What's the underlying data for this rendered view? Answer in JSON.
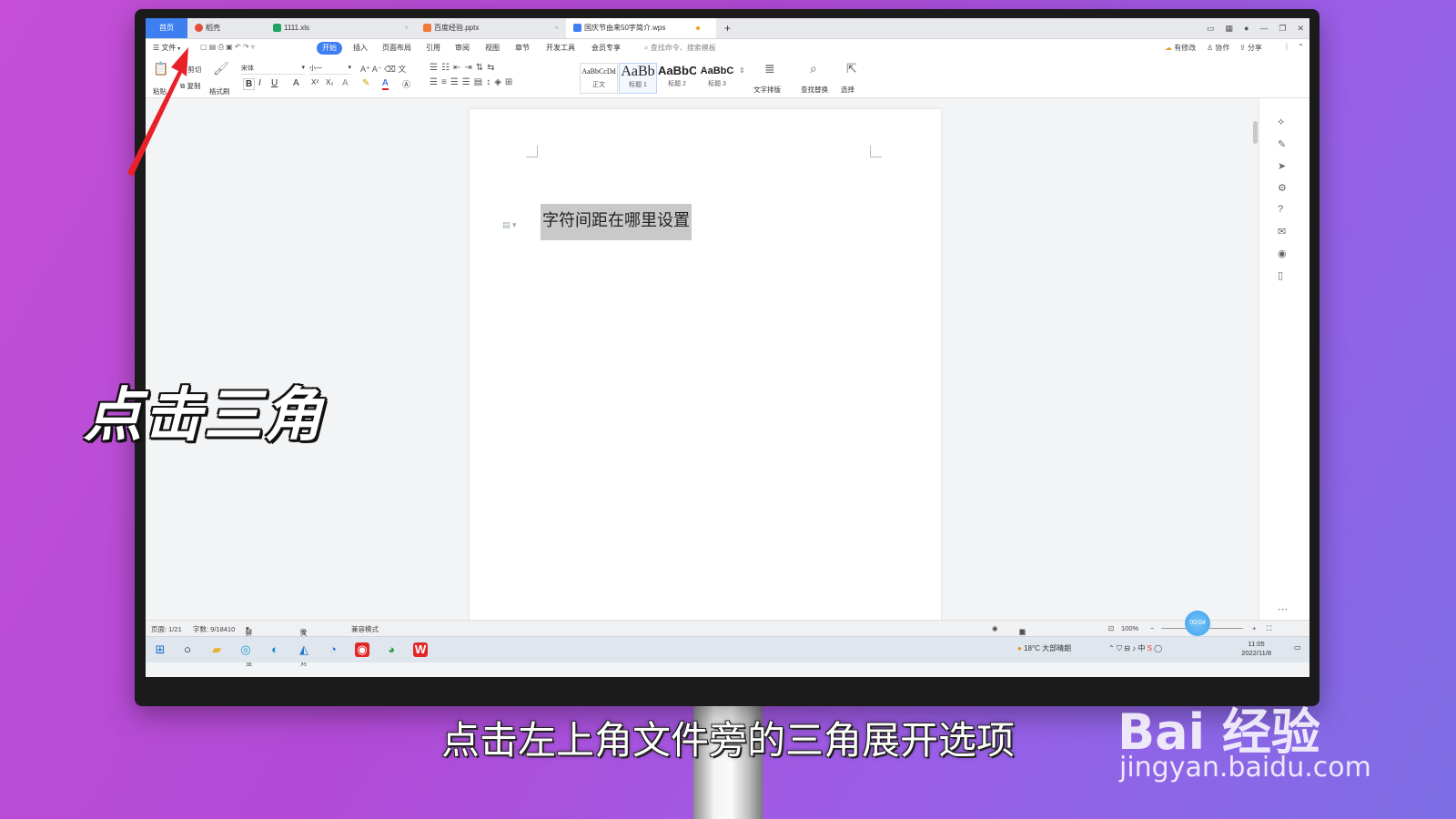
{
  "tabs": [
    {
      "label": "首页"
    },
    {
      "label": "稻壳"
    },
    {
      "label": "1111.xls"
    },
    {
      "label": "百度经验.pptx"
    },
    {
      "label": "国庆节由来50字简介.wps"
    }
  ],
  "new_tab": "+",
  "menu": {
    "file": "文件",
    "items": [
      "开始",
      "插入",
      "页面布局",
      "引用",
      "审阅",
      "视图",
      "章节",
      "开发工具",
      "会员专享"
    ],
    "search_placeholder": "查找命令、搜索模板",
    "right": [
      "有修改",
      "协作",
      "分享"
    ]
  },
  "ribbon": {
    "paste": "粘贴",
    "cut": "剪切",
    "copy": "复制",
    "format_painter": "格式刷",
    "font": "宋体",
    "size": "小一",
    "styles": [
      {
        "preview": "AaBbCcDd",
        "label": "正文"
      },
      {
        "preview": "AaBb",
        "label": "标题 1"
      },
      {
        "preview": "AaBbC",
        "label": "标题 2"
      },
      {
        "preview": "AaBbC",
        "label": "标题 3"
      }
    ],
    "text_layout": "文字排版",
    "find_replace": "查找替换",
    "select": "选择"
  },
  "document": {
    "selected_text": "字符间距在哪里设置"
  },
  "status": {
    "page": "页面: 1/21",
    "words": "字数: 9/18410",
    "spell": "拼写检查",
    "doc_check": "文档校对",
    "compat": "兼容模式",
    "zoom": "100%",
    "timer": "00:04"
  },
  "taskbar": {
    "weather": "18°C 大部晴朗",
    "time": "11:05",
    "date": "2022/11/8"
  },
  "overlay": {
    "caption": "点击三角",
    "subtitle": "点击左上角文件旁的三角展开选项",
    "watermark": "Bai 经验",
    "watermark_url": "jingyan.baidu.com"
  },
  "colors": {
    "accent": "#3d7ef0",
    "background": "#b24ad6",
    "arrow": "#e8202a"
  }
}
